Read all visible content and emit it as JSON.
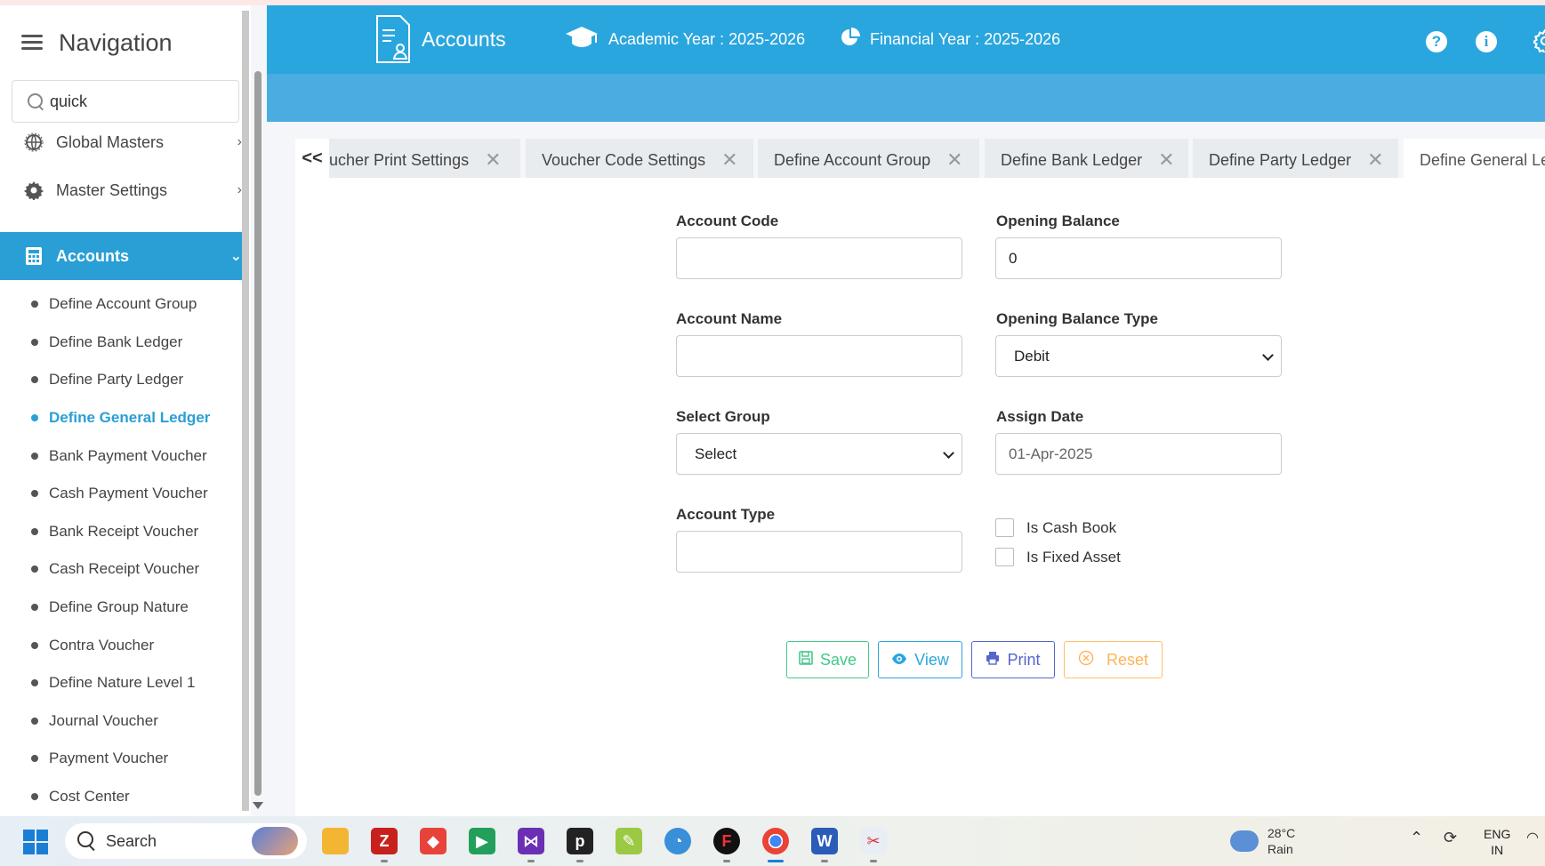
{
  "sidebar": {
    "title": "Navigation",
    "search_value": "quick",
    "menu": [
      {
        "label": "Global Masters",
        "icon": "globe-gear-icon"
      },
      {
        "label": "Master Settings",
        "icon": "gear-icon"
      },
      {
        "label": "Accounts",
        "icon": "calculator-icon"
      }
    ],
    "sub_items": [
      "Define Account Group",
      "Define Bank Ledger",
      "Define Party Ledger",
      "Define General Ledger",
      "Bank Payment Voucher",
      "Cash Payment Voucher",
      "Bank Receipt Voucher",
      "Cash Receipt Voucher",
      "Define Group Nature",
      "Contra Voucher",
      "Define Nature Level 1",
      "Journal Voucher",
      "Payment Voucher",
      "Cost Center"
    ]
  },
  "header": {
    "module": "Accounts",
    "academic_year": "Academic Year : 2025-2026",
    "financial_year": "Financial Year : 2025-2026",
    "help": "?",
    "info": "i"
  },
  "tabs": {
    "prev": "<<",
    "items": [
      "ucher Print Settings",
      "Voucher Code Settings",
      "Define Account Group",
      "Define Bank Ledger",
      "Define Party Ledger",
      "Define General Le"
    ],
    "close": "✕"
  },
  "form": {
    "account_code_label": "Account Code",
    "account_code_value": "",
    "opening_balance_label": "Opening Balance",
    "opening_balance_value": "0",
    "account_name_label": "Account Name",
    "account_name_value": "",
    "opening_balance_type_label": "Opening Balance Type",
    "opening_balance_type_value": "Debit",
    "select_group_label": "Select Group",
    "select_group_value": "Select",
    "assign_date_label": "Assign Date",
    "assign_date_value": "01-Apr-2025",
    "account_type_label": "Account Type",
    "account_type_value": "",
    "is_cash_book_label": "Is Cash Book",
    "is_cash_book_checked": false,
    "is_fixed_asset_label": "Is Fixed Asset",
    "is_fixed_asset_checked": false
  },
  "buttons": {
    "save": "Save",
    "view": "View",
    "print": "Print",
    "reset": "Reset"
  },
  "taskbar": {
    "search_label": "Search",
    "weather_temp": "28°C",
    "weather_desc": "Rain",
    "lang_1": "ENG",
    "lang_2": "IN",
    "apps": [
      "file-explorer-icon",
      "filezilla-icon",
      "git-icon",
      "meet-icon",
      "visual-studio-icon",
      "p-app-icon",
      "color-picker-icon",
      "feedback-icon",
      "security-icon",
      "chrome-icon",
      "word-icon",
      "snipping-tool-icon"
    ]
  },
  "colors": {
    "primary": "#2aa6de",
    "save": "#43c98a",
    "print": "#5566cc",
    "reset": "#ffb457"
  }
}
